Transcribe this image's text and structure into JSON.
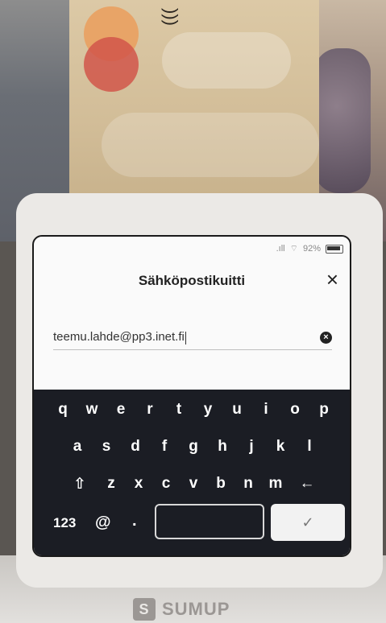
{
  "card": {
    "contactless_icon": "contactless-icon"
  },
  "status_bar": {
    "signal": ".ıll",
    "wifi": "⌔",
    "battery_percent": "92%"
  },
  "dialog": {
    "title": "Sähköpostikuitti",
    "close_icon": "×"
  },
  "email_input": {
    "value": "teemu.lahde@pp3.inet.fi",
    "clear_icon": "×"
  },
  "keyboard": {
    "row1": [
      "q",
      "w",
      "e",
      "r",
      "t",
      "y",
      "u",
      "i",
      "o",
      "p"
    ],
    "row2": [
      "a",
      "s",
      "d",
      "f",
      "g",
      "h",
      "j",
      "k",
      "l"
    ],
    "row3": [
      "z",
      "x",
      "c",
      "v",
      "b",
      "n",
      "m"
    ],
    "shift": "⇧",
    "backspace": "←",
    "numbers": "123",
    "at": "@",
    "dot": ".",
    "done": "✓"
  },
  "brand": {
    "logo_text": "SUMUP"
  },
  "colors": {
    "keyboard_bg": "#1b1d24",
    "screen_bg": "#fafafa"
  }
}
